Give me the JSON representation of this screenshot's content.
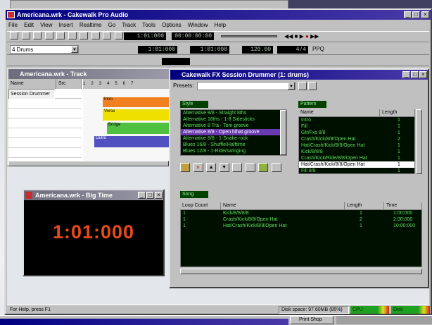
{
  "behind_window": {
    "title": ""
  },
  "main_window": {
    "title": "Americana.wrk - Cakewalk Pro Audio",
    "menu": [
      "File",
      "Edit",
      "View",
      "Insert",
      "Realtime",
      "Go",
      "Track",
      "Tools",
      "Options",
      "Window",
      "Help"
    ],
    "counter1": "1:01:000",
    "counter2": "00:00:00:00",
    "track_dropdown": "4 Drums",
    "counter3": "1:01:000",
    "counter4": "1:01:000",
    "tempo": "120.00",
    "meter": "4/4",
    "snap": "PPQ"
  },
  "track_view": {
    "title": "Americana.wrk - Track",
    "col_name": "Name",
    "col_src": "Src",
    "row1_name": "Session Drummer",
    "clips": [
      {
        "label": "Intro",
        "color": "#f08020"
      },
      {
        "label": "Verse",
        "color": "#f0e000"
      },
      {
        "label": "Bridge",
        "color": "#50c040"
      },
      {
        "label": "Outro",
        "color": "#5050c0"
      }
    ]
  },
  "big_time": {
    "title": "Americana.wrk - Big Time",
    "time": "1:01:000"
  },
  "session_drummer": {
    "title": "Cakewalk FX Session Drummer (1: drums)",
    "presets_label": "Presets:",
    "style_label": "Style",
    "styles": [
      "Alternative 8/8 - Straight 8ths",
      "Alternative 16ths - 1-8 Sidesticks",
      "Alternative 8 Tra - Tom groove",
      "Alternative 8/8 - Open hihat groove",
      "Alternative 8/8 - 1-Snake rock",
      "Blues 16/8 - Shuffle/Halftime",
      "Blues 12/8 - 1-Ride/swinging"
    ],
    "selected_style_index": 3,
    "pattern_label": "Pattern",
    "pattern_col_name": "Name",
    "pattern_col_length": "Length",
    "patterns": [
      {
        "name": "Intro",
        "length": "1"
      },
      {
        "name": "Fill",
        "length": "1"
      },
      {
        "name": "Gtr/Fxs 8/8",
        "length": "1"
      },
      {
        "name": "Crash/Kick/8/8/Open Hat",
        "length": "2"
      },
      {
        "name": "Hat/Crash/Kick/8/8/Open Hat",
        "length": "1"
      },
      {
        "name": "Kick/8/8/8",
        "length": "1"
      },
      {
        "name": "Crash/Kick/Ride/8/8/Open Hat",
        "length": "1"
      },
      {
        "name": "Hat/Crash/Kick/8/8/Open Hat",
        "length": "1"
      },
      {
        "name": "Fill 8/8",
        "length": "1"
      }
    ],
    "selected_pattern_index": 7,
    "song_label": "Song",
    "song_col_loop": "Loop Count",
    "song_col_name": "Name",
    "song_col_length": "Length",
    "song_col_time": "Time",
    "song_rows": [
      {
        "loop": "1",
        "name": "Kick/8/8/8/8",
        "length": "1",
        "time": "1:00:000"
      },
      {
        "loop": "1",
        "name": "Crash/Kick/8/8/Open Hat",
        "length": "2",
        "time": "2:00:000"
      },
      {
        "loop": "1",
        "name": "Hat/Crash/Kick/8/8/Open Hat",
        "length": "1",
        "time": "10:00:000"
      }
    ]
  },
  "status_bar": {
    "help": "For Help, press F1",
    "disk": "Disk space: 97.60MB (85%)",
    "cpu": "CPU",
    "disk_meter": "Disk"
  },
  "taskbar": {
    "item1": "Print Shop"
  }
}
